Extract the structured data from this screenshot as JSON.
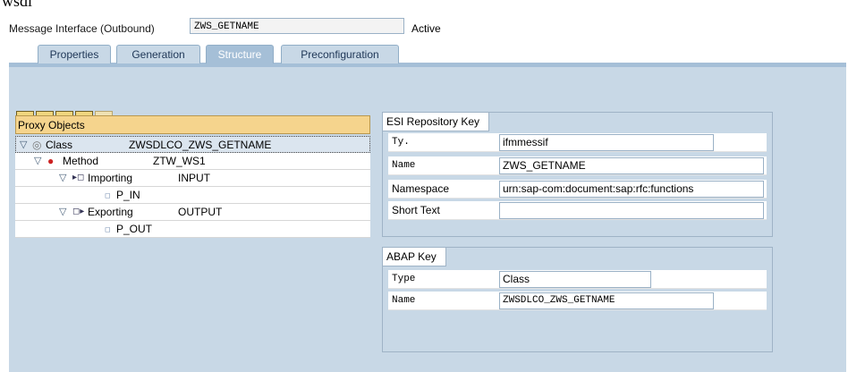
{
  "page_title_fragment": "wsdl",
  "header": {
    "label": "Message Interface (Outbound)",
    "name_value": "ZWS_GETNAME",
    "status": "Active"
  },
  "tabs": [
    {
      "label": "Properties",
      "active": false
    },
    {
      "label": "Generation",
      "active": false
    },
    {
      "label": "Structure",
      "active": true
    },
    {
      "label": "Preconfiguration",
      "active": false
    }
  ],
  "toolbar": {
    "buttons": [
      {
        "icon": "expand-all-icon",
        "glyph": "▽"
      },
      {
        "icon": "collapse-all-icon",
        "glyph": "△"
      },
      {
        "icon": "details-icon",
        "glyph": "▤"
      },
      {
        "icon": "find-icon",
        "glyph": "⊠"
      },
      {
        "icon": "find-next-icon",
        "glyph": "⊠",
        "disabled": true
      }
    ]
  },
  "tree": {
    "header": "Proxy Objects",
    "rows": [
      {
        "type": "Class",
        "name": "ZWSDLCO_ZWS_GETNAME"
      },
      {
        "type": "Method",
        "name": "ZTW_WS1"
      },
      {
        "type": "Importing",
        "name": "INPUT"
      },
      {
        "type": "P_IN",
        "name": ""
      },
      {
        "type": "Exporting",
        "name": "OUTPUT"
      },
      {
        "type": "P_OUT",
        "name": ""
      }
    ]
  },
  "esi_key": {
    "title": "ESI Repository Key",
    "fields": [
      {
        "label": "Ty.",
        "value": "ifmmessif"
      },
      {
        "label": "Name",
        "value": "ZWS_GETNAME"
      },
      {
        "label": "Namespace",
        "value": "urn:sap-com:document:sap:rfc:functions"
      },
      {
        "label": "Short Text",
        "value": ""
      }
    ]
  },
  "abap_key": {
    "title": "ABAP Key",
    "fields": [
      {
        "label": "Type",
        "value": "Class"
      },
      {
        "label": "Name",
        "value": "ZWSDLCO_ZWS_GETNAME"
      }
    ]
  }
}
